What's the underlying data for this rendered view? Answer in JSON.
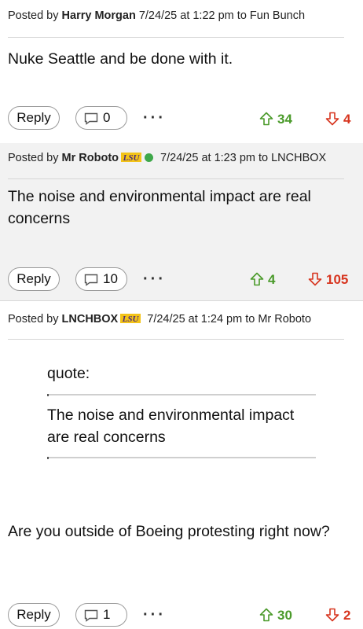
{
  "posts": [
    {
      "prefix": "Posted by",
      "author": "Harry Morgan",
      "meta": "7/24/25 at 1:22 pm to Fun Bunch",
      "body": "Nuke Seattle and be done with it.",
      "reply_label": "Reply",
      "comment_count": "0",
      "upvotes": "34",
      "downvotes": "4"
    },
    {
      "prefix": "Posted by",
      "author": "Mr Roboto",
      "badge": "LSU",
      "online": true,
      "meta": "7/24/25 at 1:23 pm to LNCHBOX",
      "body": "The noise and environmental impact are real concerns",
      "reply_label": "Reply",
      "comment_count": "10",
      "upvotes": "4",
      "downvotes": "105"
    },
    {
      "prefix": "Posted by",
      "author": "LNCHBOX",
      "badge": "LSU",
      "meta": "7/24/25 at 1:24 pm to Mr Roboto",
      "quote_label": "quote:",
      "quote_text": "The noise and environmental impact are real concerns",
      "body": "Are you outside of Boeing protesting right now?",
      "reply_label": "Reply",
      "comment_count": "1",
      "upvotes": "30",
      "downvotes": "2"
    }
  ],
  "more_label": "···",
  "colors": {
    "upvote": "#4a9a2a",
    "downvote": "#d7351f",
    "online": "#3ea84a",
    "alt_bg": "#f2f2f2"
  }
}
